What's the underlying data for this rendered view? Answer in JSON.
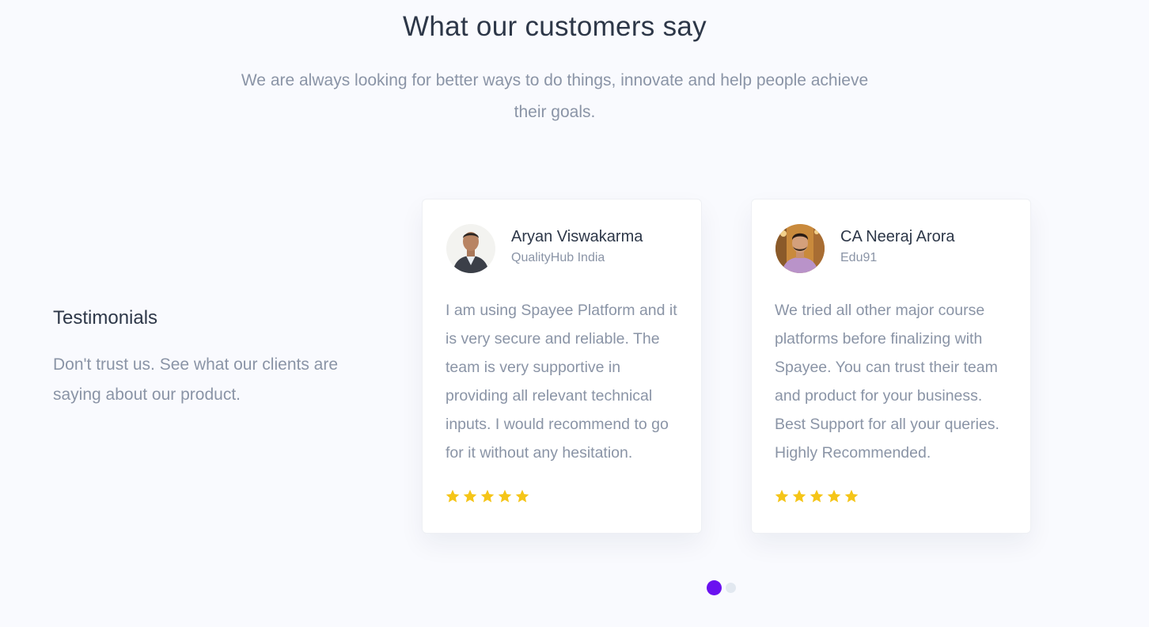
{
  "header": {
    "title": "What our customers say",
    "subtitle": "We are always looking for better ways to do things, innovate and help people achieve their goals."
  },
  "intro": {
    "heading": "Testimonials",
    "text": "Don't trust us. See what our clients are saying about our product."
  },
  "testimonials": [
    {
      "name": "Aryan Viswakarma",
      "company": "QualityHub India",
      "quote": "I am using Spayee Platform and it is very secure and reliable. The team is very supportive in providing all relevant technical inputs. I would recommend to go for it without any hesitation.",
      "rating": 5,
      "avatar_icon": "person-photo"
    },
    {
      "name": "CA Neeraj Arora",
      "company": "Edu91",
      "quote": "We tried all other major course platforms before finalizing with Spayee. You can trust their team and product for your business. Best Support for all your queries. Highly Recommended.",
      "rating": 5,
      "avatar_icon": "person-photo"
    }
  ],
  "carousel": {
    "total_pages": 2,
    "active_page": 1
  },
  "colors": {
    "accent": "#6a11f0",
    "star": "#f5c518",
    "heading": "#2d3748",
    "muted": "#8a94a6",
    "background": "#f9fafe"
  }
}
